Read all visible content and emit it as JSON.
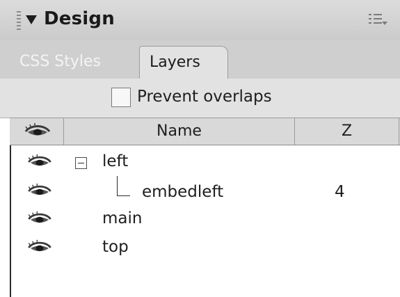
{
  "panel": {
    "title": "Design",
    "options_icon": "panel-options-icon",
    "grip_icon": "grip-icon",
    "collapse_icon": "triangle-down-icon"
  },
  "tabs": [
    {
      "label": "CSS Styles",
      "active": false
    },
    {
      "label": "Layers",
      "active": true
    }
  ],
  "options": {
    "prevent_overlaps_label": "Prevent overlaps",
    "prevent_overlaps_checked": false
  },
  "columns": {
    "visibility_icon": "eye-icon",
    "name": "Name",
    "z": "Z"
  },
  "layers": [
    {
      "name": "left",
      "z": "",
      "expanded": true,
      "depth": 0
    },
    {
      "name": "embedleft",
      "z": "4",
      "depth": 1
    },
    {
      "name": "main",
      "z": "",
      "depth": 0
    },
    {
      "name": "top",
      "z": "",
      "depth": 0
    }
  ],
  "colors": {
    "header_bg": "#cbcbcb",
    "tab_active_bg": "#e2e2e2",
    "list_bg": "#ffffff"
  }
}
